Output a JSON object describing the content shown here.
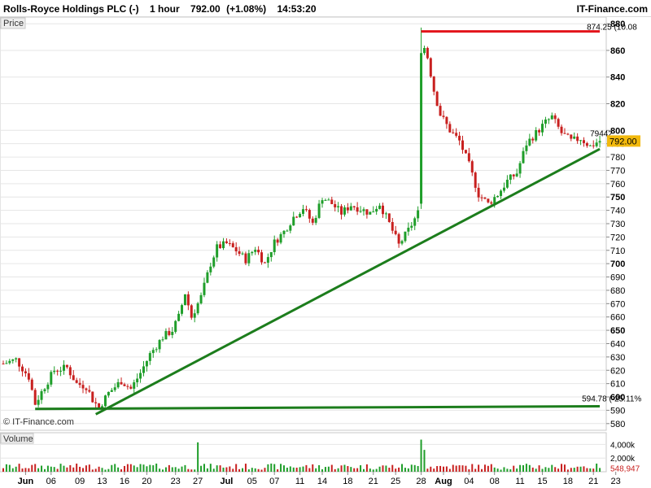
{
  "header": {
    "instrument": "Rolls-Royce Holdings PLC (-)",
    "interval": "1 hour",
    "price": "792.00",
    "change": "(+1.08%)",
    "time": "14:53:20",
    "brand": "IT-Finance.com"
  },
  "price_panel_label": "Price",
  "volume_panel_label": "Volume",
  "watermark": "© IT-Finance.com",
  "current_price_tag": "792.00",
  "line_labels": {
    "resistance": "874.25 (10.08",
    "support": "594.78 (-25.11%",
    "trend_overlap": "79442"
  },
  "colors": {
    "up": "#1f9e2a",
    "down": "#c8201f",
    "trend": "#1c7d1c",
    "resistance": "#e3141b",
    "tag_bg": "#f2b90d",
    "grid": "#e6e6e6"
  },
  "chart_data": {
    "type": "candlestick",
    "price_axis": {
      "min": 575,
      "max": 885,
      "ticks": [
        580,
        590,
        600,
        610,
        620,
        630,
        640,
        650,
        660,
        670,
        680,
        690,
        700,
        710,
        720,
        730,
        740,
        750,
        760,
        770,
        780,
        790,
        800,
        820,
        840,
        860,
        880
      ],
      "bold_ticks": [
        600,
        650,
        700,
        750,
        800,
        820,
        840,
        860,
        880
      ]
    },
    "volume_axis": {
      "min": 0,
      "max": 5000,
      "ticks": [
        "4,000k",
        "2,000k"
      ],
      "tick_values": [
        4000,
        2000
      ],
      "last_label": "548,947",
      "last_value": 549
    },
    "x_axis": {
      "ticks": [
        {
          "label": "Jun",
          "idx": 7,
          "bold": true
        },
        {
          "label": "06",
          "idx": 15
        },
        {
          "label": "09",
          "idx": 24
        },
        {
          "label": "13",
          "idx": 31
        },
        {
          "label": "16",
          "idx": 38
        },
        {
          "label": "20",
          "idx": 45
        },
        {
          "label": "23",
          "idx": 54
        },
        {
          "label": "27",
          "idx": 61
        },
        {
          "label": "Jul",
          "idx": 70,
          "bold": true
        },
        {
          "label": "05",
          "idx": 78
        },
        {
          "label": "07",
          "idx": 85
        },
        {
          "label": "11",
          "idx": 93
        },
        {
          "label": "14",
          "idx": 100
        },
        {
          "label": "18",
          "idx": 108
        },
        {
          "label": "21",
          "idx": 116
        },
        {
          "label": "25",
          "idx": 123
        },
        {
          "label": "28",
          "idx": 131
        },
        {
          "label": "Aug",
          "idx": 138,
          "bold": true
        },
        {
          "label": "04",
          "idx": 146
        },
        {
          "label": "08",
          "idx": 154
        },
        {
          "label": "11",
          "idx": 162
        },
        {
          "label": "15",
          "idx": 169
        },
        {
          "label": "18",
          "idx": 177
        },
        {
          "label": "21",
          "idx": 185
        },
        {
          "label": "23",
          "idx": 192
        }
      ]
    },
    "anchors": [
      [
        0,
        625
      ],
      [
        4,
        628
      ],
      [
        8,
        615
      ],
      [
        10,
        595
      ],
      [
        13,
        608
      ],
      [
        16,
        620
      ],
      [
        20,
        622
      ],
      [
        23,
        610
      ],
      [
        26,
        608
      ],
      [
        28,
        598
      ],
      [
        30,
        592
      ],
      [
        33,
        603
      ],
      [
        37,
        612
      ],
      [
        40,
        606
      ],
      [
        43,
        618
      ],
      [
        46,
        632
      ],
      [
        50,
        645
      ],
      [
        53,
        650
      ],
      [
        55,
        660
      ],
      [
        57,
        678
      ],
      [
        59,
        660
      ],
      [
        62,
        675
      ],
      [
        65,
        700
      ],
      [
        67,
        712
      ],
      [
        70,
        715
      ],
      [
        73,
        710
      ],
      [
        76,
        703
      ],
      [
        79,
        712
      ],
      [
        82,
        700
      ],
      [
        85,
        716
      ],
      [
        88,
        724
      ],
      [
        91,
        735
      ],
      [
        94,
        742
      ],
      [
        97,
        730
      ],
      [
        100,
        750
      ],
      [
        103,
        745
      ],
      [
        106,
        738
      ],
      [
        109,
        744
      ],
      [
        112,
        741
      ],
      [
        115,
        738
      ],
      [
        118,
        745
      ],
      [
        121,
        730
      ],
      [
        124,
        714
      ],
      [
        127,
        725
      ],
      [
        130,
        738
      ],
      [
        131,
        745
      ],
      [
        131.4,
        742
      ],
      [
        131.5,
        770
      ],
      [
        132,
        862
      ],
      [
        133,
        855
      ],
      [
        135,
        830
      ],
      [
        137,
        812
      ],
      [
        140,
        800
      ],
      [
        143,
        792
      ],
      [
        146,
        774
      ],
      [
        149,
        752
      ],
      [
        152,
        745
      ],
      [
        155,
        752
      ],
      [
        158,
        762
      ],
      [
        161,
        768
      ],
      [
        164,
        790
      ],
      [
        167,
        798
      ],
      [
        170,
        806
      ],
      [
        172,
        810
      ],
      [
        175,
        798
      ],
      [
        178,
        792
      ],
      [
        181,
        794
      ],
      [
        184,
        788
      ],
      [
        186,
        791
      ],
      [
        187,
        792
      ]
    ],
    "candle_count": 188,
    "volume_spikes": [
      {
        "idx": 61,
        "value": 4300
      },
      {
        "idx": 131,
        "value": 4700
      },
      {
        "idx": 132,
        "value": 3200
      }
    ],
    "lines": [
      {
        "name": "Resistance",
        "from": {
          "idx": 131,
          "price": 874.25
        },
        "to": {
          "idx": 187,
          "price": 874.25
        }
      },
      {
        "name": "Trendline",
        "from": {
          "idx": 29,
          "price": 587
        },
        "to": {
          "idx": 187,
          "price": 786
        }
      },
      {
        "name": "Support",
        "from": {
          "idx": 10,
          "price": 591
        },
        "to": {
          "idx": 187,
          "price": 593
        }
      }
    ],
    "last_close": 792.0
  }
}
